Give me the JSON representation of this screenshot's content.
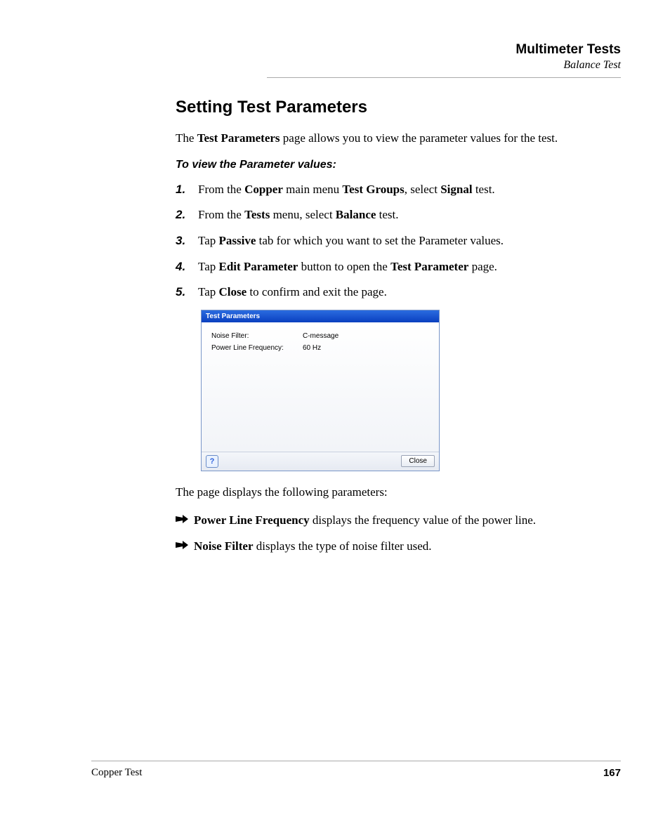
{
  "header": {
    "chapter": "Multimeter Tests",
    "section": "Balance Test"
  },
  "title": "Setting Test Parameters",
  "intro": {
    "pre": "The ",
    "b1": "Test Parameters",
    "post": " page allows you to view the parameter values for the test."
  },
  "subhead": "To view the Parameter values:",
  "steps": [
    {
      "num": "1.",
      "t": [
        {
          "s": "From the "
        },
        {
          "b": "Copper"
        },
        {
          "s": " main menu "
        },
        {
          "b": "Test Groups"
        },
        {
          "s": ", select "
        },
        {
          "b": "Signal"
        },
        {
          "s": " test."
        }
      ]
    },
    {
      "num": "2.",
      "t": [
        {
          "s": "From the "
        },
        {
          "b": "Tests"
        },
        {
          "s": " menu, select "
        },
        {
          "b": "Balance"
        },
        {
          "s": " test."
        }
      ]
    },
    {
      "num": "3.",
      "t": [
        {
          "s": "Tap "
        },
        {
          "b": "Passive"
        },
        {
          "s": " tab for which you want to set the Parameter values."
        }
      ]
    },
    {
      "num": "4.",
      "t": [
        {
          "s": "Tap "
        },
        {
          "b": "Edit Parameter"
        },
        {
          "s": " button to open the "
        },
        {
          "b": "Test Parameter"
        },
        {
          "s": " page."
        }
      ]
    },
    {
      "num": "5.",
      "t": [
        {
          "s": "Tap "
        },
        {
          "b": "Close"
        },
        {
          "s": " to confirm and exit the page."
        }
      ]
    }
  ],
  "screenshot": {
    "title": "Test Parameters",
    "rows": [
      {
        "k": "Noise Filter:",
        "v": "C-message"
      },
      {
        "k": "Power Line Frequency:",
        "v": "60 Hz"
      }
    ],
    "help": "?",
    "close": "Close"
  },
  "after": "The page displays the following parameters:",
  "bullets": [
    {
      "b": "Power Line Frequency",
      "s": " displays the frequency value of the power line."
    },
    {
      "b": "Noise Filter",
      "s": " displays the type of noise filter used."
    }
  ],
  "footer": {
    "left": "Copper Test",
    "page": "167"
  }
}
